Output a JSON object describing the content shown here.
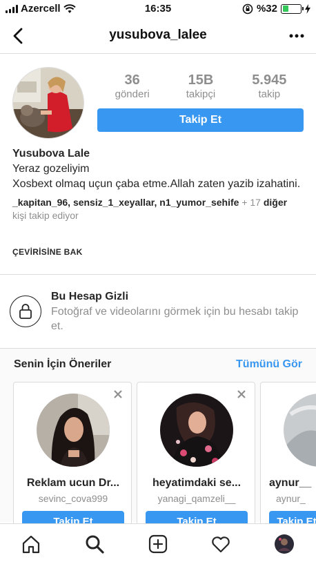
{
  "status_bar": {
    "carrier": "Azercell",
    "time": "16:35",
    "battery_percent": "%32",
    "battery_level": 0.32
  },
  "header": {
    "username": "yusubova_lalee",
    "back_icon": "chevron-left-icon",
    "more_icon": "ellipsis-icon"
  },
  "profile": {
    "stats": [
      {
        "value": "36",
        "label": "gönderi"
      },
      {
        "value": "15B",
        "label": "takipçi"
      },
      {
        "value": "5.945",
        "label": "takip"
      }
    ],
    "follow_label": "Takip Et",
    "name": "Yusubova Lale",
    "bio_line1": "Yeraz gozeliyim",
    "bio_line2": "Xosbext olmaq uçun çaba etme.Allah zaten yazib izahatini.",
    "followed_by_names": "_kapitan_96, sensiz_1_xeyallar, n1_yumor_sehife",
    "followed_by_more": "+ 17",
    "followed_by_more_word": "diğer",
    "followed_by_suffix": "kişi takip ediyor",
    "translate_label": "ÇEVİRİSİNE BAK"
  },
  "private": {
    "title": "Bu Hesap Gizli",
    "text": "Fotoğraf ve videolarını görmek için bu hesabı takip et."
  },
  "suggestions": {
    "title": "Senin İçin Öneriler",
    "see_all": "Tümünü Gör",
    "cards": [
      {
        "name": "Reklam ucun Dr...",
        "handle": "sevinc_cova999",
        "button": "Takip Et"
      },
      {
        "name": "heyatimdaki se...",
        "handle": "yanagi_qamzeli__",
        "button": "Takip Et"
      },
      {
        "name": "aynur__",
        "handle": "aynur_",
        "button": "Takip Et"
      }
    ]
  },
  "tabbar": {
    "items": [
      "home-icon",
      "search-icon",
      "add-icon",
      "heart-icon",
      "profile-avatar-icon"
    ]
  },
  "colors": {
    "accent": "#3897f0",
    "text": "#262626",
    "muted": "#8e8e8e",
    "border": "#dbdbdb"
  }
}
